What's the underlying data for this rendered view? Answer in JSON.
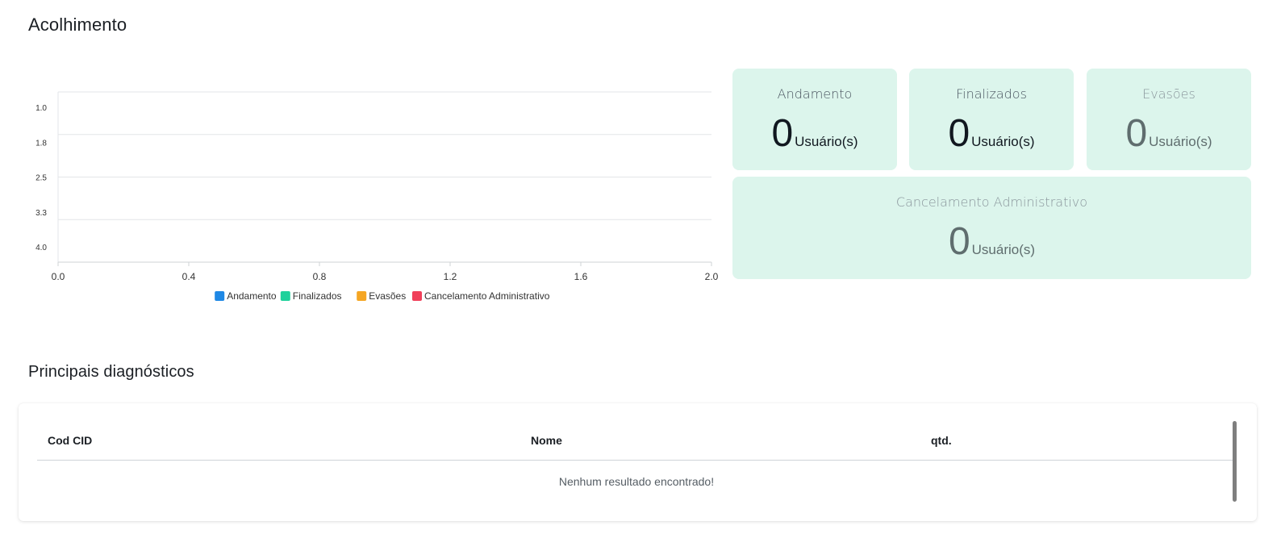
{
  "header": {
    "title": "Acolhimento"
  },
  "chart_data": {
    "type": "bar",
    "orientation": "horizontal",
    "y_ticks": [
      "1.0",
      "1.8",
      "2.5",
      "3.3",
      "4.0"
    ],
    "x_ticks": [
      "0.0",
      "0.4",
      "0.8",
      "1.2",
      "1.6",
      "2.0"
    ],
    "xlim": [
      0,
      2
    ],
    "series": [
      {
        "name": "Andamento",
        "values": [],
        "color": "#1e88e5"
      },
      {
        "name": "Finalizados",
        "values": [],
        "color": "#1fd19b"
      },
      {
        "name": "Evasões",
        "values": [],
        "color": "#f5a623"
      },
      {
        "name": "Cancelamento Administrativo",
        "values": [],
        "color": "#f0405a"
      }
    ],
    "grid": true,
    "legend_position": "bottom"
  },
  "stats": {
    "andamento": {
      "label": "Andamento",
      "value": "0",
      "unit": "Usuário(s)"
    },
    "finalizados": {
      "label": "Finalizados",
      "value": "0",
      "unit": "Usuário(s)"
    },
    "evasoes": {
      "label": "Evasões",
      "value": "0",
      "unit": "Usuário(s)"
    },
    "cancelamento": {
      "label": "Cancelamento Administrativo",
      "value": "0",
      "unit": "Usuário(s)"
    }
  },
  "diagnosticos": {
    "title": "Principais diagnósticos",
    "columns": [
      "Cod CID",
      "Nome",
      "qtd."
    ],
    "empty_message": "Nenhum resultado encontrado!"
  },
  "colors": {
    "card_bg": "#dcf5ec"
  }
}
